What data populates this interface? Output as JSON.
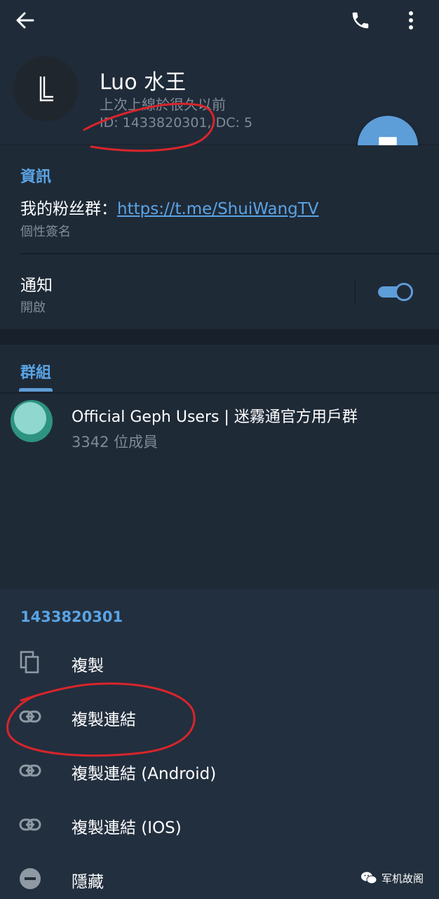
{
  "header": {
    "back_icon": "arrow-left-icon",
    "call_icon": "phone-icon",
    "more_icon": "more-vertical-icon"
  },
  "profile": {
    "avatar_letter": "L",
    "name": "Luo 水王",
    "last_seen": "上次上線於很久以前",
    "id_line": "ID: 1433820301, DC: 5",
    "message_fab_icon": "chat-bubble-icon"
  },
  "info": {
    "section_title": "資訊",
    "bio_prefix": "我的粉丝群：",
    "bio_link": "https://t.me/ShuiWangTV",
    "bio_caption": "個性簽名",
    "notifications_title": "通知",
    "notifications_status": "開啟",
    "notifications_enabled": true
  },
  "groups": {
    "tab_title": "群組",
    "items": [
      {
        "name": "Official Geph Users | 迷霧通官方用戶群",
        "members": "3342 位成員"
      }
    ]
  },
  "sheet": {
    "title": "1433820301",
    "items": [
      {
        "label": "複製",
        "icon": "copy-icon"
      },
      {
        "label": "複製連結",
        "icon": "link-icon"
      },
      {
        "label": "複製連結 (Android)",
        "icon": "link-icon"
      },
      {
        "label": "複製連結 (IOS)",
        "icon": "link-icon"
      },
      {
        "label": "隱藏",
        "icon": "minus-circle-icon"
      }
    ]
  },
  "watermark": {
    "text": "军机故阁",
    "icon": "wechat-icon"
  },
  "colors": {
    "accent": "#5d9dd8",
    "link": "#5aa4e5",
    "background": "#1b2530",
    "annotation": "#d8252b"
  }
}
